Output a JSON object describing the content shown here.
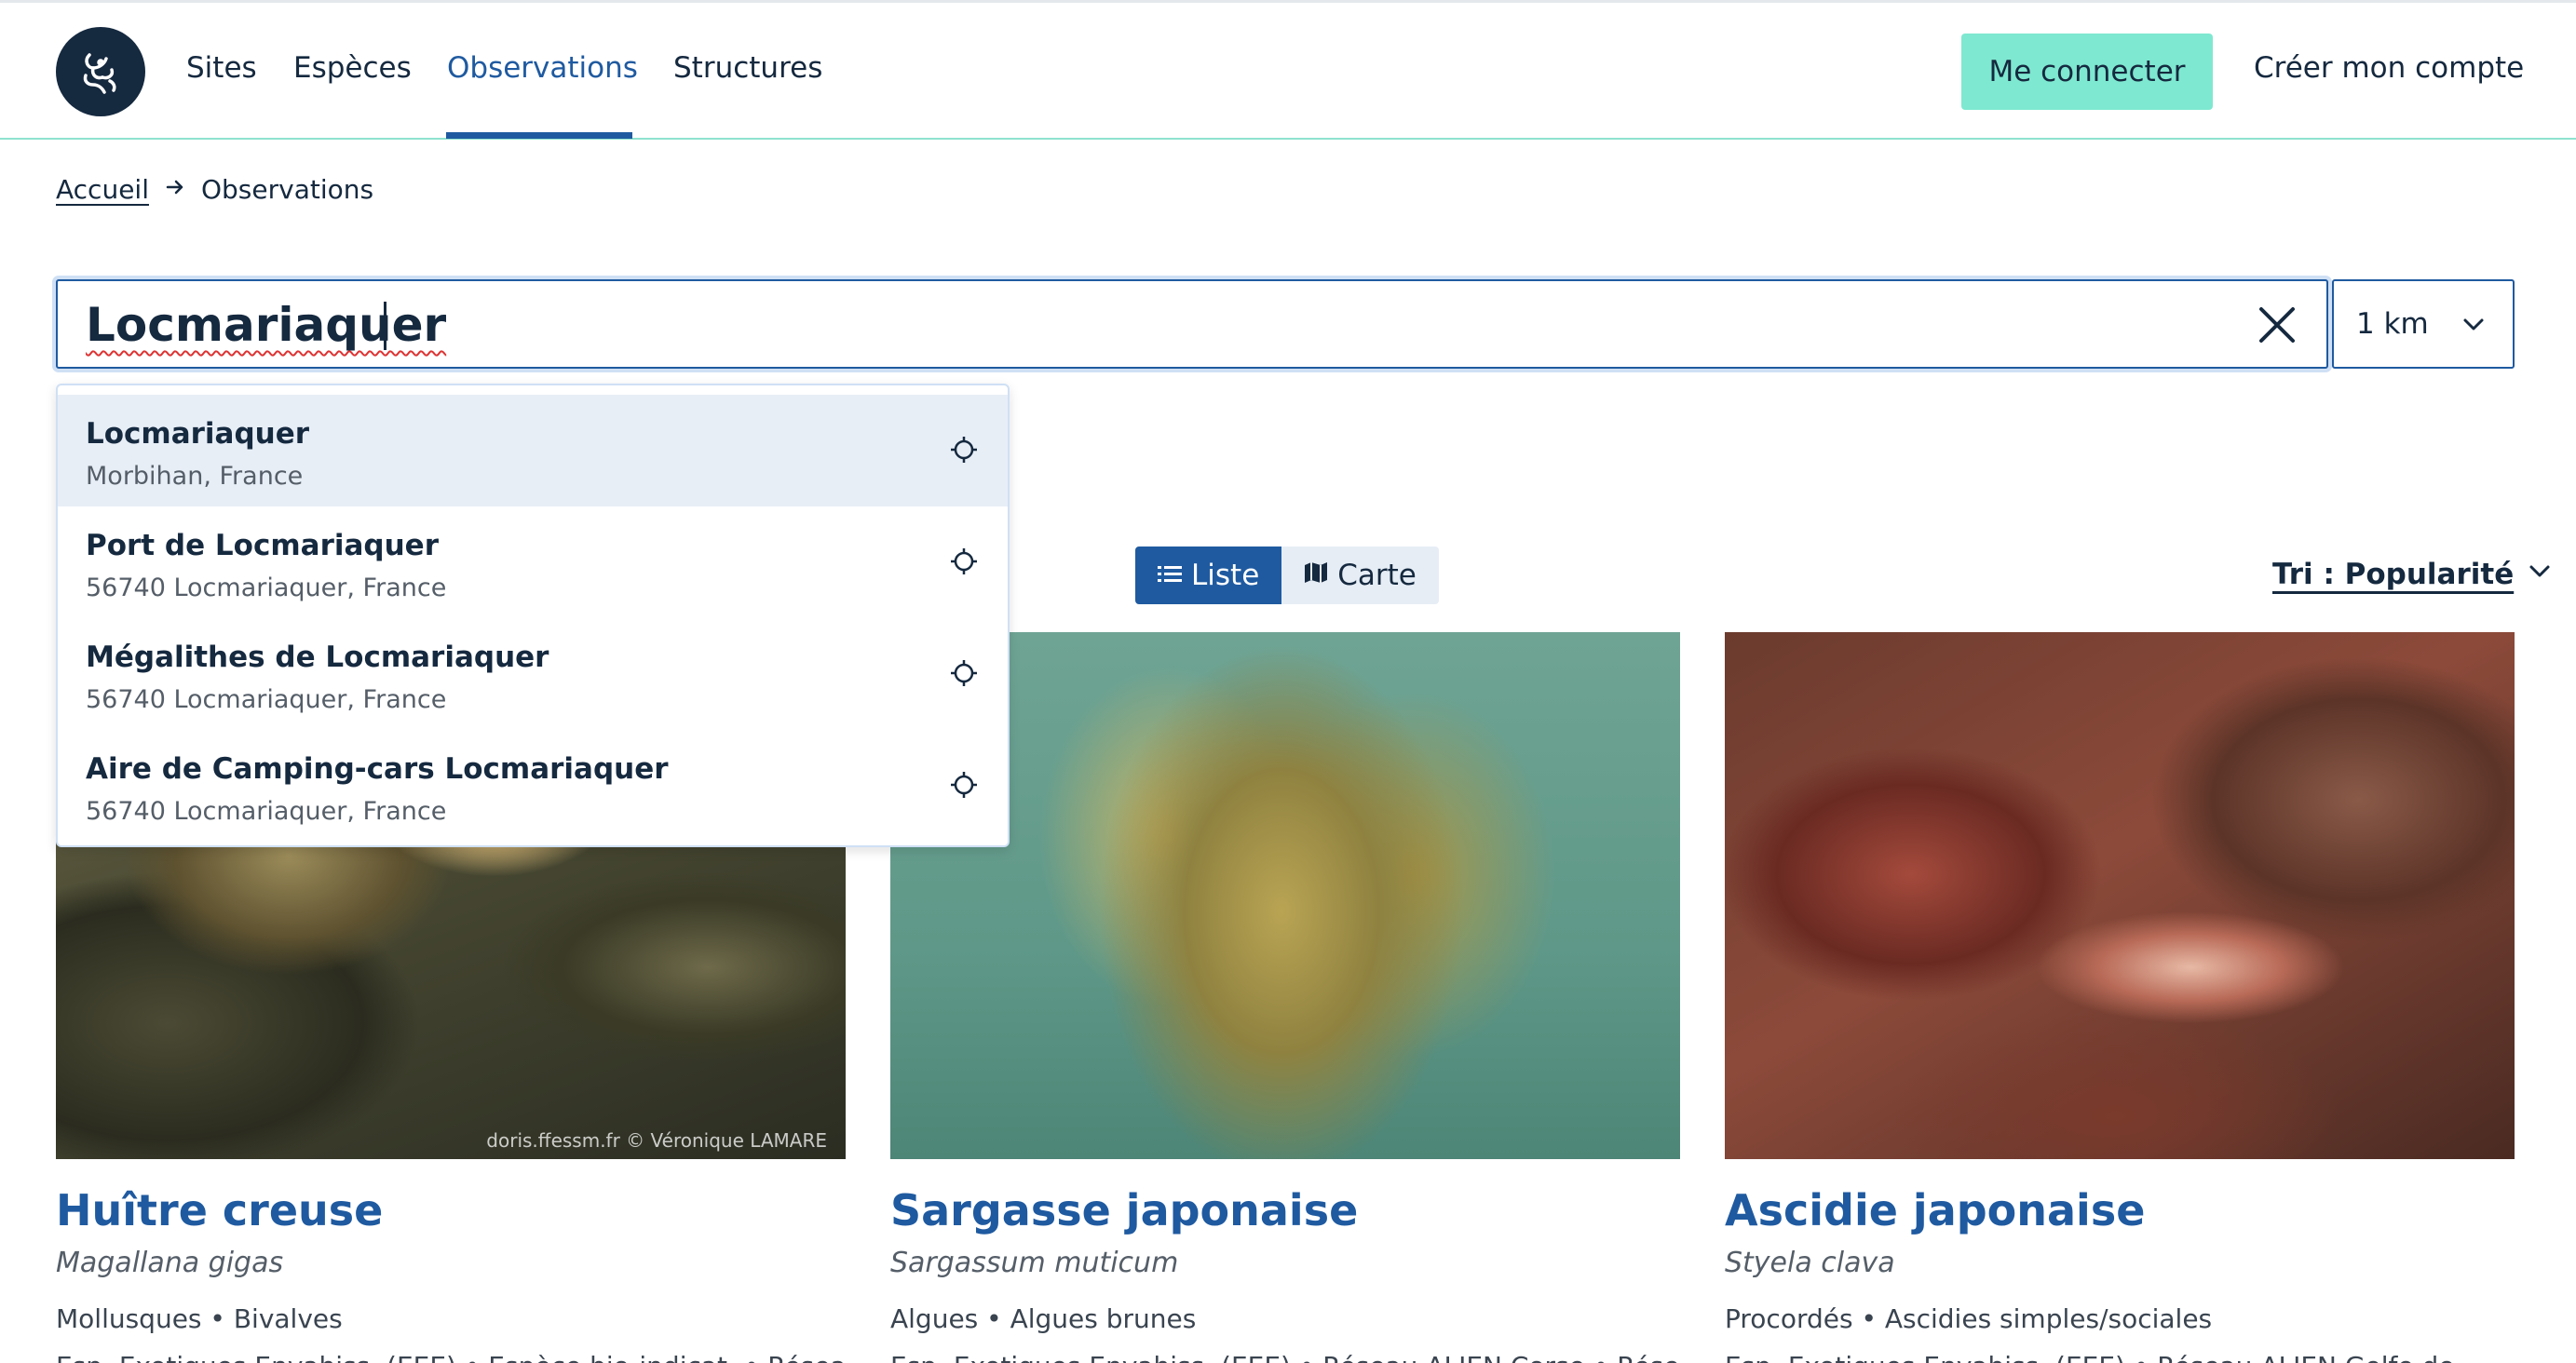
{
  "header": {
    "logo_icon": "octopus-logo-icon",
    "nav": [
      {
        "label": "Sites",
        "active": false
      },
      {
        "label": "Espèces",
        "active": false
      },
      {
        "label": "Observations",
        "active": true
      },
      {
        "label": "Structures",
        "active": false
      }
    ],
    "login_label": "Me connecter",
    "signup_label": "Créer mon compte"
  },
  "breadcrumb": {
    "home": "Accueil",
    "separator_icon": "arrow-right-icon",
    "current": "Observations"
  },
  "search": {
    "value": "Locmariaquer",
    "clear_icon": "close-icon",
    "radius": "1 km",
    "radius_icon": "chevron-down-icon"
  },
  "suggestions": [
    {
      "title": "Locmariaquer",
      "subtitle": "Morbihan, France"
    },
    {
      "title": "Port de Locmariaquer",
      "subtitle": "56740 Locmariaquer, France"
    },
    {
      "title": "Mégalithes de Locmariaquer",
      "subtitle": "56740 Locmariaquer, France"
    },
    {
      "title": "Aire de Camping-cars Locmariaquer",
      "subtitle": "56740 Locmariaquer, France"
    }
  ],
  "view": {
    "list_label": "Liste",
    "map_label": "Carte",
    "active": "Liste"
  },
  "sort": {
    "label": "Tri : Popularité"
  },
  "cards": [
    {
      "name": "Huître creuse",
      "scientific": "Magallana gigas",
      "taxonomy": "Mollusques • Bivalves",
      "tags": "Esp. Exotiques Envahiss. (EEE) • Espèce bio-indicat. • Réseau",
      "credit": "doris.ffessm.fr  ©  Véronique LAMARE"
    },
    {
      "name": "Sargasse japonaise",
      "scientific": "Sargassum muticum",
      "taxonomy": "Algues • Algues brunes",
      "tags": "Esp. Exotiques Envahiss. (EEE) • Réseau ALIEN Corse • Réseau",
      "credit": ""
    },
    {
      "name": "Ascidie japonaise",
      "scientific": "Styela clava",
      "taxonomy": "Procordés • Ascidies simples/sociales",
      "tags": "Esp. Exotiques Envahiss. (EEE) • Réseau ALIEN Golfe de",
      "credit": ""
    }
  ],
  "colors": {
    "primary": "#1f5aa0",
    "accent": "#7ee8d0",
    "dark": "#15293f"
  }
}
